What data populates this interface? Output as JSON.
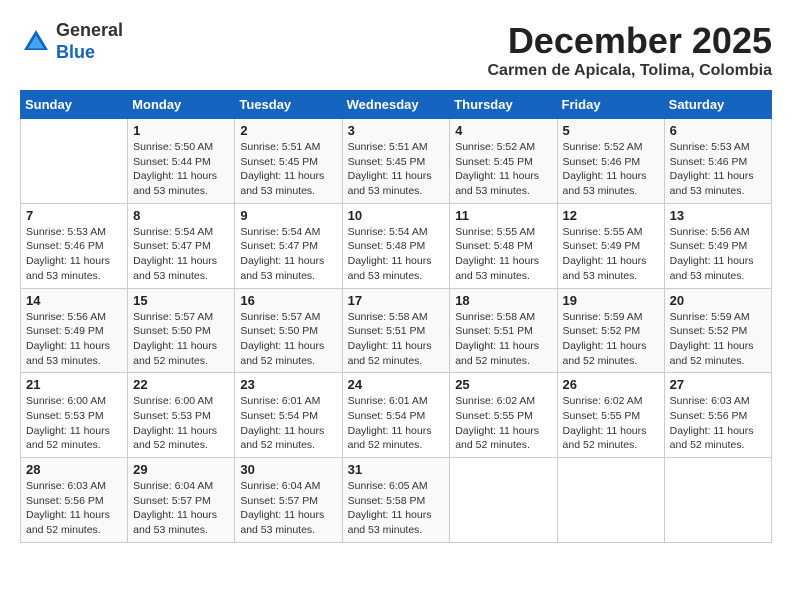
{
  "logo": {
    "general": "General",
    "blue": "Blue"
  },
  "title": {
    "month_year": "December 2025",
    "location": "Carmen de Apicala, Tolima, Colombia"
  },
  "header": {
    "days": [
      "Sunday",
      "Monday",
      "Tuesday",
      "Wednesday",
      "Thursday",
      "Friday",
      "Saturday"
    ]
  },
  "weeks": [
    [
      {
        "day": "",
        "info": ""
      },
      {
        "day": "1",
        "info": "Sunrise: 5:50 AM\nSunset: 5:44 PM\nDaylight: 11 hours\nand 53 minutes."
      },
      {
        "day": "2",
        "info": "Sunrise: 5:51 AM\nSunset: 5:45 PM\nDaylight: 11 hours\nand 53 minutes."
      },
      {
        "day": "3",
        "info": "Sunrise: 5:51 AM\nSunset: 5:45 PM\nDaylight: 11 hours\nand 53 minutes."
      },
      {
        "day": "4",
        "info": "Sunrise: 5:52 AM\nSunset: 5:45 PM\nDaylight: 11 hours\nand 53 minutes."
      },
      {
        "day": "5",
        "info": "Sunrise: 5:52 AM\nSunset: 5:46 PM\nDaylight: 11 hours\nand 53 minutes."
      },
      {
        "day": "6",
        "info": "Sunrise: 5:53 AM\nSunset: 5:46 PM\nDaylight: 11 hours\nand 53 minutes."
      }
    ],
    [
      {
        "day": "7",
        "info": "Sunrise: 5:53 AM\nSunset: 5:46 PM\nDaylight: 11 hours\nand 53 minutes."
      },
      {
        "day": "8",
        "info": "Sunrise: 5:54 AM\nSunset: 5:47 PM\nDaylight: 11 hours\nand 53 minutes."
      },
      {
        "day": "9",
        "info": "Sunrise: 5:54 AM\nSunset: 5:47 PM\nDaylight: 11 hours\nand 53 minutes."
      },
      {
        "day": "10",
        "info": "Sunrise: 5:54 AM\nSunset: 5:48 PM\nDaylight: 11 hours\nand 53 minutes."
      },
      {
        "day": "11",
        "info": "Sunrise: 5:55 AM\nSunset: 5:48 PM\nDaylight: 11 hours\nand 53 minutes."
      },
      {
        "day": "12",
        "info": "Sunrise: 5:55 AM\nSunset: 5:49 PM\nDaylight: 11 hours\nand 53 minutes."
      },
      {
        "day": "13",
        "info": "Sunrise: 5:56 AM\nSunset: 5:49 PM\nDaylight: 11 hours\nand 53 minutes."
      }
    ],
    [
      {
        "day": "14",
        "info": "Sunrise: 5:56 AM\nSunset: 5:49 PM\nDaylight: 11 hours\nand 53 minutes."
      },
      {
        "day": "15",
        "info": "Sunrise: 5:57 AM\nSunset: 5:50 PM\nDaylight: 11 hours\nand 52 minutes."
      },
      {
        "day": "16",
        "info": "Sunrise: 5:57 AM\nSunset: 5:50 PM\nDaylight: 11 hours\nand 52 minutes."
      },
      {
        "day": "17",
        "info": "Sunrise: 5:58 AM\nSunset: 5:51 PM\nDaylight: 11 hours\nand 52 minutes."
      },
      {
        "day": "18",
        "info": "Sunrise: 5:58 AM\nSunset: 5:51 PM\nDaylight: 11 hours\nand 52 minutes."
      },
      {
        "day": "19",
        "info": "Sunrise: 5:59 AM\nSunset: 5:52 PM\nDaylight: 11 hours\nand 52 minutes."
      },
      {
        "day": "20",
        "info": "Sunrise: 5:59 AM\nSunset: 5:52 PM\nDaylight: 11 hours\nand 52 minutes."
      }
    ],
    [
      {
        "day": "21",
        "info": "Sunrise: 6:00 AM\nSunset: 5:53 PM\nDaylight: 11 hours\nand 52 minutes."
      },
      {
        "day": "22",
        "info": "Sunrise: 6:00 AM\nSunset: 5:53 PM\nDaylight: 11 hours\nand 52 minutes."
      },
      {
        "day": "23",
        "info": "Sunrise: 6:01 AM\nSunset: 5:54 PM\nDaylight: 11 hours\nand 52 minutes."
      },
      {
        "day": "24",
        "info": "Sunrise: 6:01 AM\nSunset: 5:54 PM\nDaylight: 11 hours\nand 52 minutes."
      },
      {
        "day": "25",
        "info": "Sunrise: 6:02 AM\nSunset: 5:55 PM\nDaylight: 11 hours\nand 52 minutes."
      },
      {
        "day": "26",
        "info": "Sunrise: 6:02 AM\nSunset: 5:55 PM\nDaylight: 11 hours\nand 52 minutes."
      },
      {
        "day": "27",
        "info": "Sunrise: 6:03 AM\nSunset: 5:56 PM\nDaylight: 11 hours\nand 52 minutes."
      }
    ],
    [
      {
        "day": "28",
        "info": "Sunrise: 6:03 AM\nSunset: 5:56 PM\nDaylight: 11 hours\nand 52 minutes."
      },
      {
        "day": "29",
        "info": "Sunrise: 6:04 AM\nSunset: 5:57 PM\nDaylight: 11 hours\nand 53 minutes."
      },
      {
        "day": "30",
        "info": "Sunrise: 6:04 AM\nSunset: 5:57 PM\nDaylight: 11 hours\nand 53 minutes."
      },
      {
        "day": "31",
        "info": "Sunrise: 6:05 AM\nSunset: 5:58 PM\nDaylight: 11 hours\nand 53 minutes."
      },
      {
        "day": "",
        "info": ""
      },
      {
        "day": "",
        "info": ""
      },
      {
        "day": "",
        "info": ""
      }
    ]
  ]
}
